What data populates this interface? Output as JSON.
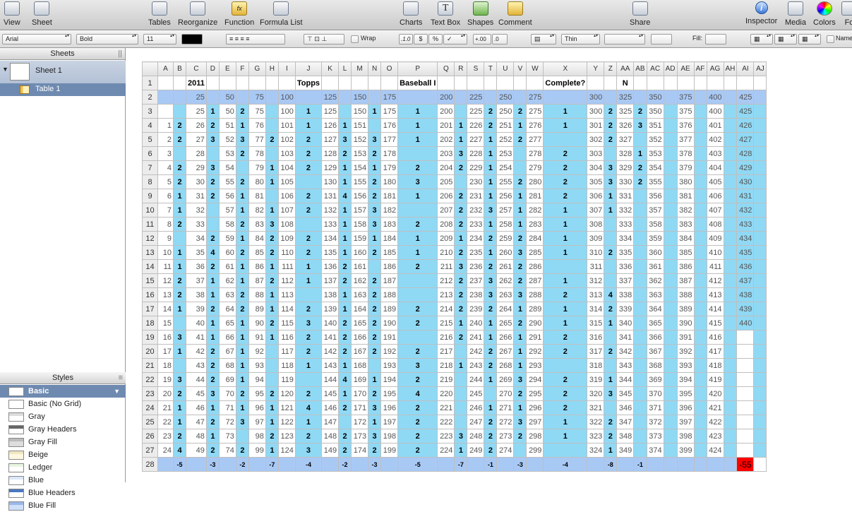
{
  "toolbar": {
    "items": [
      {
        "label": "View",
        "icon": "view-icon"
      },
      {
        "label": "Sheet",
        "icon": "sheet-icon"
      },
      {
        "label": "Tables",
        "icon": "tables-icon"
      },
      {
        "label": "Reorganize",
        "icon": "reorganize-icon"
      },
      {
        "label": "Function",
        "icon": "function-icon"
      },
      {
        "label": "Formula List",
        "icon": "formula-list-icon"
      },
      {
        "label": "Charts",
        "icon": "charts-icon"
      },
      {
        "label": "Text Box",
        "icon": "text-box-icon"
      },
      {
        "label": "Shapes",
        "icon": "shapes-icon"
      },
      {
        "label": "Comment",
        "icon": "comment-icon"
      },
      {
        "label": "Share",
        "icon": "share-icon"
      },
      {
        "label": "Inspector",
        "icon": "inspector-icon"
      },
      {
        "label": "Media",
        "icon": "media-icon"
      },
      {
        "label": "Colors",
        "icon": "colors-icon"
      },
      {
        "label": "Fo",
        "icon": "fonts-icon"
      }
    ],
    "function_glyph": "fx",
    "textbox_glyph": "T",
    "inspector_glyph": "i"
  },
  "format_bar": {
    "font": "Arial",
    "style": "Bold",
    "size": "11",
    "wrap_label": "Wrap",
    "num_1": ".1.0",
    "num_currency": "$",
    "num_percent": "%",
    "num_check": "✓",
    "num_inc": "+.00",
    "num_dec": ".0",
    "stroke": "Thin",
    "fill_label": "Fill:",
    "name_label": "Name"
  },
  "sidebar": {
    "sheets_header": "Sheets",
    "sheet_name": "Sheet 1",
    "table_name": "Table 1",
    "styles_header": "Styles",
    "styles": [
      "Basic",
      "Basic (No Grid)",
      "Gray",
      "Gray Headers",
      "Gray Fill",
      "Beige",
      "Ledger",
      "Blue",
      "Blue Headers",
      "Blue Fill"
    ]
  },
  "sheet": {
    "columns": [
      "A",
      "B",
      "C",
      "D",
      "E",
      "F",
      "G",
      "H",
      "I",
      "J",
      "K",
      "L",
      "M",
      "N",
      "O",
      "P",
      "Q",
      "R",
      "S",
      "T",
      "U",
      "V",
      "W",
      "X",
      "Y",
      "Z",
      "AA",
      "AB",
      "AC",
      "AD",
      "AE",
      "AF",
      "AG",
      "AH",
      "AI",
      "AJ"
    ],
    "header_row1": {
      "C": "2011",
      "J": "Topps",
      "P": "Baseball I",
      "X": "Complete?",
      "AA": "N"
    },
    "header_row2": {
      "C": "25",
      "E": "50",
      "G": "75",
      "I": "100",
      "K": "125",
      "M": "150",
      "O": "175",
      "Q": "200",
      "S": "225",
      "U": "250",
      "W": "275",
      "Y": "300",
      "AA": "325",
      "AC": "350",
      "AE": "375",
      "AG": "400",
      "AI": "425"
    },
    "rows": [
      [
        "",
        "",
        "25",
        "1",
        "50",
        "2",
        "75",
        "",
        "100",
        "1",
        "125",
        "",
        "150",
        "1",
        "175",
        "1",
        "200",
        "",
        "225",
        "2",
        "250",
        "2",
        "275",
        "1",
        "300",
        "2",
        "325",
        "2",
        "350",
        "",
        "375",
        "",
        "400",
        "",
        "425",
        ""
      ],
      [
        "1",
        "2",
        "26",
        "2",
        "51",
        "1",
        "76",
        "",
        "101",
        "1",
        "126",
        "1",
        "151",
        "",
        "176",
        "1",
        "201",
        "1",
        "226",
        "2",
        "251",
        "1",
        "276",
        "1",
        "301",
        "2",
        "326",
        "3",
        "351",
        "",
        "376",
        "",
        "401",
        "",
        "426",
        ""
      ],
      [
        "2",
        "2",
        "27",
        "3",
        "52",
        "3",
        "77",
        "2",
        "102",
        "2",
        "127",
        "3",
        "152",
        "3",
        "177",
        "1",
        "202",
        "1",
        "227",
        "1",
        "252",
        "2",
        "277",
        "",
        "302",
        "2",
        "327",
        "",
        "352",
        "",
        "377",
        "",
        "402",
        "",
        "427",
        ""
      ],
      [
        "3",
        "",
        "28",
        "",
        "53",
        "2",
        "78",
        "",
        "103",
        "2",
        "128",
        "2",
        "153",
        "2",
        "178",
        "",
        "203",
        "3",
        "228",
        "1",
        "253",
        "",
        "278",
        "2",
        "303",
        "",
        "328",
        "1",
        "353",
        "",
        "378",
        "",
        "403",
        "",
        "428",
        ""
      ],
      [
        "4",
        "2",
        "29",
        "3",
        "54",
        "",
        "79",
        "1",
        "104",
        "2",
        "129",
        "1",
        "154",
        "1",
        "179",
        "2",
        "204",
        "2",
        "229",
        "1",
        "254",
        "",
        "279",
        "2",
        "304",
        "3",
        "329",
        "2",
        "354",
        "",
        "379",
        "",
        "404",
        "",
        "429",
        ""
      ],
      [
        "5",
        "2",
        "30",
        "2",
        "55",
        "2",
        "80",
        "1",
        "105",
        "",
        "130",
        "1",
        "155",
        "2",
        "180",
        "3",
        "205",
        "",
        "230",
        "1",
        "255",
        "2",
        "280",
        "2",
        "305",
        "3",
        "330",
        "2",
        "355",
        "",
        "380",
        "",
        "405",
        "",
        "430",
        ""
      ],
      [
        "6",
        "1",
        "31",
        "2",
        "56",
        "1",
        "81",
        "",
        "106",
        "2",
        "131",
        "4",
        "156",
        "2",
        "181",
        "1",
        "206",
        "2",
        "231",
        "1",
        "256",
        "1",
        "281",
        "2",
        "306",
        "1",
        "331",
        "",
        "356",
        "",
        "381",
        "",
        "406",
        "",
        "431",
        ""
      ],
      [
        "7",
        "1",
        "32",
        "",
        "57",
        "1",
        "82",
        "1",
        "107",
        "2",
        "132",
        "1",
        "157",
        "3",
        "182",
        "",
        "207",
        "2",
        "232",
        "3",
        "257",
        "1",
        "282",
        "1",
        "307",
        "1",
        "332",
        "",
        "357",
        "",
        "382",
        "",
        "407",
        "",
        "432",
        ""
      ],
      [
        "8",
        "2",
        "33",
        "",
        "58",
        "2",
        "83",
        "3",
        "108",
        "",
        "133",
        "1",
        "158",
        "3",
        "183",
        "2",
        "208",
        "2",
        "233",
        "1",
        "258",
        "1",
        "283",
        "1",
        "308",
        "",
        "333",
        "",
        "358",
        "",
        "383",
        "",
        "408",
        "",
        "433",
        ""
      ],
      [
        "9",
        "",
        "34",
        "2",
        "59",
        "1",
        "84",
        "2",
        "109",
        "2",
        "134",
        "1",
        "159",
        "1",
        "184",
        "1",
        "209",
        "1",
        "234",
        "2",
        "259",
        "2",
        "284",
        "1",
        "309",
        "",
        "334",
        "",
        "359",
        "",
        "384",
        "",
        "409",
        "",
        "434",
        ""
      ],
      [
        "10",
        "1",
        "35",
        "4",
        "60",
        "2",
        "85",
        "2",
        "110",
        "2",
        "135",
        "1",
        "160",
        "2",
        "185",
        "1",
        "210",
        "2",
        "235",
        "1",
        "260",
        "3",
        "285",
        "1",
        "310",
        "2",
        "335",
        "",
        "360",
        "",
        "385",
        "",
        "410",
        "",
        "435",
        ""
      ],
      [
        "11",
        "1",
        "36",
        "2",
        "61",
        "1",
        "86",
        "1",
        "111",
        "1",
        "136",
        "2",
        "161",
        "",
        "186",
        "2",
        "211",
        "3",
        "236",
        "2",
        "261",
        "2",
        "286",
        "",
        "311",
        "",
        "336",
        "",
        "361",
        "",
        "386",
        "",
        "411",
        "",
        "436",
        ""
      ],
      [
        "12",
        "2",
        "37",
        "1",
        "62",
        "1",
        "87",
        "2",
        "112",
        "1",
        "137",
        "2",
        "162",
        "2",
        "187",
        "",
        "212",
        "2",
        "237",
        "3",
        "262",
        "2",
        "287",
        "1",
        "312",
        "",
        "337",
        "",
        "362",
        "",
        "387",
        "",
        "412",
        "",
        "437",
        ""
      ],
      [
        "13",
        "2",
        "38",
        "1",
        "63",
        "2",
        "88",
        "1",
        "113",
        "",
        "138",
        "1",
        "163",
        "2",
        "188",
        "",
        "213",
        "2",
        "238",
        "3",
        "263",
        "3",
        "288",
        "2",
        "313",
        "4",
        "338",
        "",
        "363",
        "",
        "388",
        "",
        "413",
        "",
        "438",
        ""
      ],
      [
        "14",
        "1",
        "39",
        "2",
        "64",
        "2",
        "89",
        "1",
        "114",
        "2",
        "139",
        "1",
        "164",
        "2",
        "189",
        "2",
        "214",
        "2",
        "239",
        "2",
        "264",
        "1",
        "289",
        "1",
        "314",
        "2",
        "339",
        "",
        "364",
        "",
        "389",
        "",
        "414",
        "",
        "439",
        ""
      ],
      [
        "15",
        "",
        "40",
        "1",
        "65",
        "1",
        "90",
        "2",
        "115",
        "3",
        "140",
        "2",
        "165",
        "2",
        "190",
        "2",
        "215",
        "1",
        "240",
        "1",
        "265",
        "2",
        "290",
        "1",
        "315",
        "1",
        "340",
        "",
        "365",
        "",
        "390",
        "",
        "415",
        "",
        "440",
        ""
      ],
      [
        "16",
        "3",
        "41",
        "1",
        "66",
        "1",
        "91",
        "1",
        "116",
        "2",
        "141",
        "2",
        "166",
        "2",
        "191",
        "",
        "216",
        "2",
        "241",
        "1",
        "266",
        "1",
        "291",
        "2",
        "316",
        "",
        "341",
        "",
        "366",
        "",
        "391",
        "",
        "416",
        "",
        "",
        ""
      ],
      [
        "17",
        "1",
        "42",
        "2",
        "67",
        "1",
        "92",
        "",
        "117",
        "2",
        "142",
        "2",
        "167",
        "2",
        "192",
        "2",
        "217",
        "",
        "242",
        "2",
        "267",
        "1",
        "292",
        "2",
        "317",
        "2",
        "342",
        "",
        "367",
        "",
        "392",
        "",
        "417",
        "",
        "",
        ""
      ],
      [
        "18",
        "",
        "43",
        "2",
        "68",
        "1",
        "93",
        "",
        "118",
        "1",
        "143",
        "1",
        "168",
        "",
        "193",
        "3",
        "218",
        "1",
        "243",
        "2",
        "268",
        "1",
        "293",
        "",
        "318",
        "",
        "343",
        "",
        "368",
        "",
        "393",
        "",
        "418",
        "",
        "",
        ""
      ],
      [
        "19",
        "3",
        "44",
        "2",
        "69",
        "1",
        "94",
        "",
        "119",
        "",
        "144",
        "4",
        "169",
        "1",
        "194",
        "2",
        "219",
        "",
        "244",
        "1",
        "269",
        "3",
        "294",
        "2",
        "319",
        "1",
        "344",
        "",
        "369",
        "",
        "394",
        "",
        "419",
        "",
        "",
        ""
      ],
      [
        "20",
        "2",
        "45",
        "3",
        "70",
        "2",
        "95",
        "2",
        "120",
        "2",
        "145",
        "1",
        "170",
        "2",
        "195",
        "4",
        "220",
        "",
        "245",
        "",
        "270",
        "2",
        "295",
        "2",
        "320",
        "3",
        "345",
        "",
        "370",
        "",
        "395",
        "",
        "420",
        "",
        "",
        ""
      ],
      [
        "21",
        "1",
        "46",
        "1",
        "71",
        "1",
        "96",
        "1",
        "121",
        "4",
        "146",
        "2",
        "171",
        "3",
        "196",
        "2",
        "221",
        "",
        "246",
        "1",
        "271",
        "1",
        "296",
        "2",
        "321",
        "",
        "346",
        "",
        "371",
        "",
        "396",
        "",
        "421",
        "",
        "",
        ""
      ],
      [
        "22",
        "1",
        "47",
        "2",
        "72",
        "3",
        "97",
        "1",
        "122",
        "1",
        "147",
        "",
        "172",
        "1",
        "197",
        "2",
        "222",
        "",
        "247",
        "2",
        "272",
        "3",
        "297",
        "1",
        "322",
        "2",
        "347",
        "",
        "372",
        "",
        "397",
        "",
        "422",
        "",
        "",
        ""
      ],
      [
        "23",
        "2",
        "48",
        "1",
        "73",
        "",
        "98",
        "2",
        "123",
        "2",
        "148",
        "2",
        "173",
        "3",
        "198",
        "2",
        "223",
        "3",
        "248",
        "2",
        "273",
        "2",
        "298",
        "1",
        "323",
        "2",
        "348",
        "",
        "373",
        "",
        "398",
        "",
        "423",
        "",
        "",
        ""
      ],
      [
        "24",
        "4",
        "49",
        "2",
        "74",
        "2",
        "99",
        "1",
        "124",
        "3",
        "149",
        "2",
        "174",
        "2",
        "199",
        "2",
        "224",
        "1",
        "249",
        "2",
        "274",
        "",
        "299",
        "",
        "324",
        "1",
        "349",
        "",
        "374",
        "",
        "399",
        "",
        "424",
        "",
        "",
        ""
      ]
    ],
    "footer": {
      "B": "-5",
      "D": "-3",
      "F": "-2",
      "H": "-7",
      "J": "-4",
      "L": "-2",
      "N": "-3",
      "P": "-5",
      "R": "-7",
      "T": "-1",
      "V": "-3",
      "X": "-4",
      "Z": "-8",
      "AB": "-1"
    },
    "total": "-55"
  },
  "colors": {
    "header_blue": "#a9c9f5",
    "cyan": "#8fd9f5",
    "total_red": "#ff0000"
  }
}
